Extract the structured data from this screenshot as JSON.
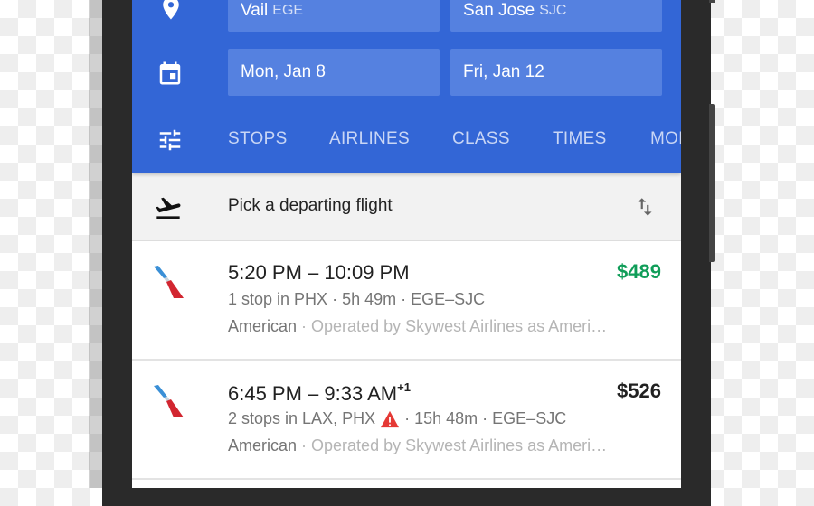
{
  "search": {
    "origin": {
      "city": "Vail",
      "code": "EGE"
    },
    "destination": {
      "city": "San Jose",
      "code": "SJC"
    },
    "depart_date": "Mon, Jan 8",
    "return_date": "Fri, Jan 12"
  },
  "filters": [
    "STOPS",
    "AIRLINES",
    "CLASS",
    "TIMES",
    "MORE"
  ],
  "section": {
    "title": "Pick a departing flight",
    "icon": "flight-takeoff-icon",
    "sort_icon": "sort-arrows-icon"
  },
  "flights": [
    {
      "times": "5:20 PM – 10:09 PM",
      "day_offset": "",
      "price": "$489",
      "price_color": "#0f9d58",
      "stops": "1 stop in PHX",
      "warning": false,
      "duration": "5h 49m",
      "route": "EGE–SJC",
      "airline": "American",
      "operated": "Operated by Skywest Airlines as Ameri…"
    },
    {
      "times": "6:45 PM – 9:33 AM",
      "day_offset": "+1",
      "price": "$526",
      "price_color": "#212121",
      "stops": "2 stops in LAX, PHX",
      "warning": true,
      "duration": "15h 48m",
      "route": "EGE–SJC",
      "airline": "American",
      "operated": "Operated by Skywest Airlines as Ameri…"
    }
  ],
  "colors": {
    "header": "#3366d6",
    "field": "#5581e0",
    "best_price": "#0f9d58",
    "warning": "#e53935"
  }
}
